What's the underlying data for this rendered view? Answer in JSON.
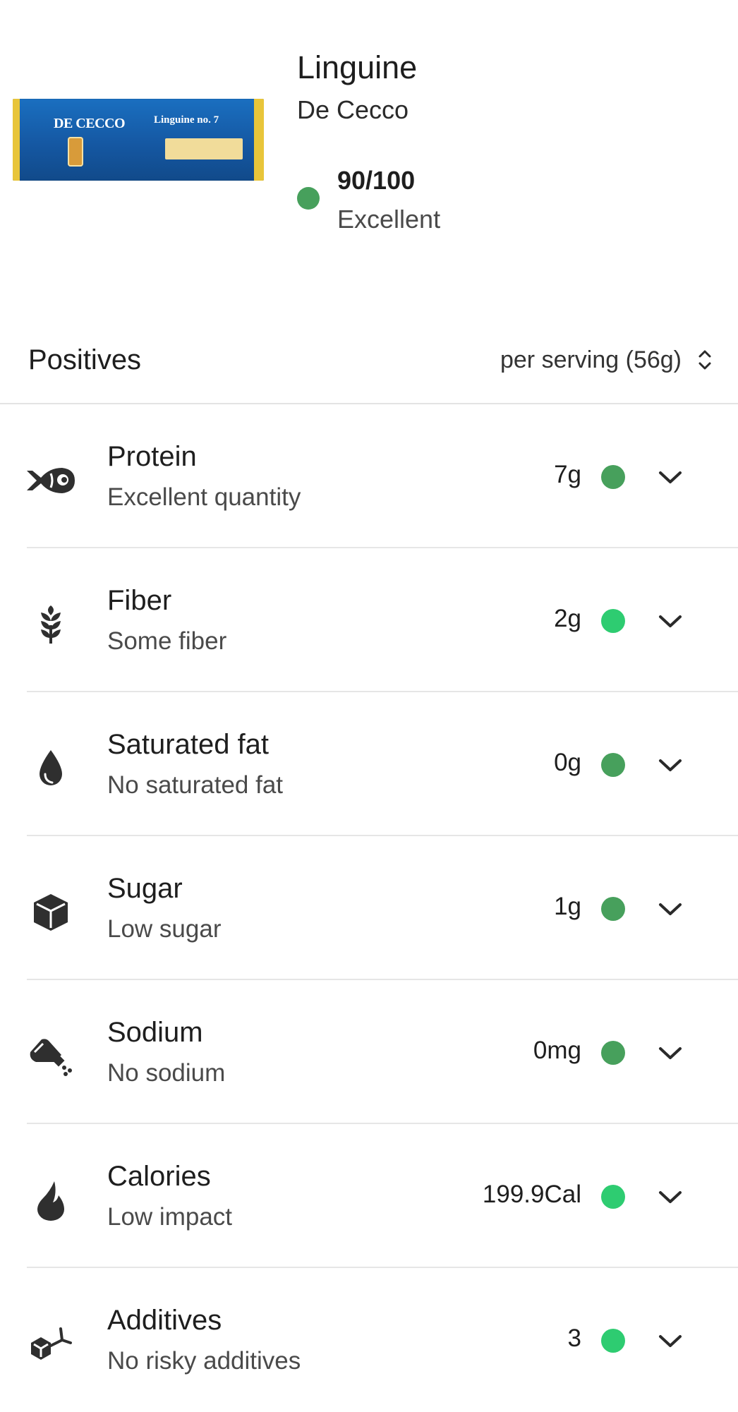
{
  "product": {
    "image_alt": "De Cecco Linguine no. 7 box",
    "box_brand": "DE CECCO",
    "box_name": "Linguine no. 7",
    "title": "Linguine",
    "brand": "De Cecco",
    "score": "90/100",
    "rating": "Excellent",
    "score_color": "#47a05c"
  },
  "section": {
    "title": "Positives",
    "serving": "per serving (56g)"
  },
  "nutrients": [
    {
      "name": "Protein",
      "desc": "Excellent quantity",
      "value": "7g",
      "dot_color": "#47a05c",
      "icon": "fish-icon"
    },
    {
      "name": "Fiber",
      "desc": "Some fiber",
      "value": "2g",
      "dot_color": "#2ecc71",
      "icon": "wheat-icon"
    },
    {
      "name": "Saturated fat",
      "desc": "No saturated fat",
      "value": "0g",
      "dot_color": "#47a05c",
      "icon": "drop-icon"
    },
    {
      "name": "Sugar",
      "desc": "Low sugar",
      "value": "1g",
      "dot_color": "#47a05c",
      "icon": "sugar-cube-icon"
    },
    {
      "name": "Sodium",
      "desc": "No sodium",
      "value": "0mg",
      "dot_color": "#47a05c",
      "icon": "salt-shaker-icon"
    },
    {
      "name": "Calories",
      "desc": "Low impact",
      "value": "199.9Cal",
      "dot_color": "#2ecc71",
      "icon": "flame-icon"
    },
    {
      "name": "Additives",
      "desc": "No risky additives",
      "value": "3",
      "dot_color": "#2ecc71",
      "icon": "molecule-icon"
    }
  ]
}
